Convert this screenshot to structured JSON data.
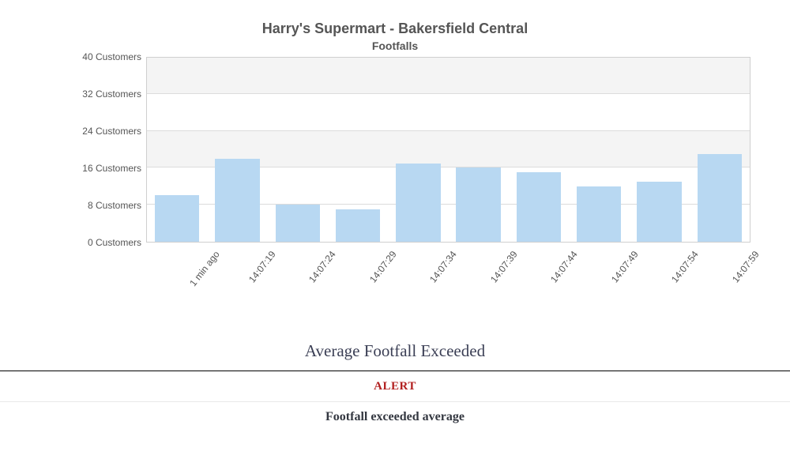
{
  "chart_data": {
    "type": "bar",
    "title": "Harry's Supermart - Bakersfield Central",
    "subtitle": "Footfalls",
    "xlabel": "",
    "ylabel": "",
    "y_unit": "Customers",
    "ylim": [
      0,
      40
    ],
    "y_ticks": [
      0,
      8,
      16,
      24,
      32,
      40
    ],
    "y_tick_labels": [
      "0 Customers",
      "8 Customers",
      "16 Customers",
      "24 Customers",
      "32 Customers",
      "40 Customers"
    ],
    "categories": [
      "1 min ago",
      "14:07:19",
      "14:07:24",
      "14:07:29",
      "14:07:34",
      "14:07:39",
      "14:07:44",
      "14:07:49",
      "14:07:54",
      "14:07:59"
    ],
    "values": [
      10,
      18,
      8,
      7,
      17,
      16,
      15,
      12,
      13,
      19
    ]
  },
  "alert": {
    "heading": "Average Footfall Exceeded",
    "badge": "ALERT",
    "message": "Footfall exceeded average"
  }
}
